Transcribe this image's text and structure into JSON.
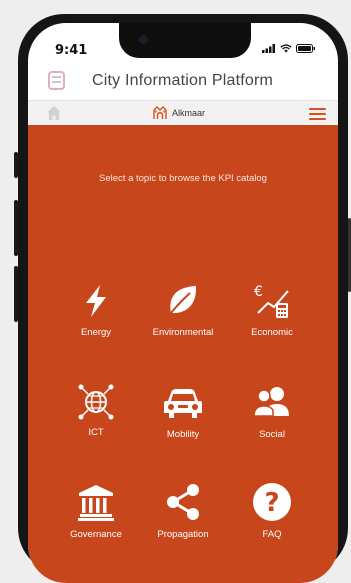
{
  "status_bar": {
    "time": "9:41"
  },
  "app": {
    "title": "City Information Platform"
  },
  "nav": {
    "city": "Alkmaar"
  },
  "main": {
    "prompt": "Select a topic to browse the KPI catalog",
    "topics": [
      {
        "label": "Energy",
        "icon": "lightning-icon"
      },
      {
        "label": "Environmental",
        "icon": "leaf-icon"
      },
      {
        "label": "Economic",
        "icon": "economic-icon"
      },
      {
        "label": "ICT",
        "icon": "globe-network-icon"
      },
      {
        "label": "Mobility",
        "icon": "car-icon"
      },
      {
        "label": "Social",
        "icon": "users-icon"
      },
      {
        "label": "Governance",
        "icon": "institution-icon"
      },
      {
        "label": "Propagation",
        "icon": "share-icon"
      },
      {
        "label": "FAQ",
        "icon": "question-icon"
      }
    ]
  },
  "colors": {
    "accent": "#c8461b",
    "menu": "#d8501e"
  }
}
